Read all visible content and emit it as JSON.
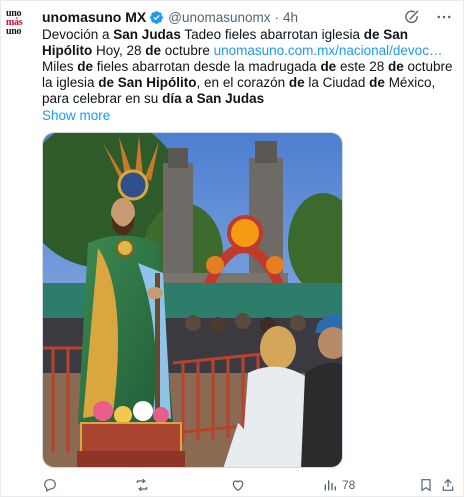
{
  "account": {
    "avatar_lines": [
      "uno",
      "más",
      "uno"
    ],
    "name": "unomasuno MX",
    "handle": "@unomasunomx",
    "separator": "·",
    "time": "4h"
  },
  "tweet": {
    "line1": [
      {
        "t": "Devoción a ",
        "s": "n"
      },
      {
        "t": "San Judas",
        "s": "b"
      },
      {
        "t": " Tadeo fieles abarrotan iglesia ",
        "s": "n"
      },
      {
        "t": "de San Hipólito",
        "s": "b"
      },
      {
        "t": " Hoy, 28 ",
        "s": "n"
      },
      {
        "t": "de",
        "s": "b"
      },
      {
        "t": " octubre ",
        "s": "n"
      },
      {
        "t": "unomasuno.com.mx/nacional/devoc…",
        "s": "link"
      }
    ],
    "line2": [
      {
        "t": "Miles ",
        "s": "n"
      },
      {
        "t": "de",
        "s": "b"
      },
      {
        "t": " fieles abarrotan desde la madrugada ",
        "s": "n"
      },
      {
        "t": "de",
        "s": "b"
      },
      {
        "t": " este 28 ",
        "s": "n"
      },
      {
        "t": "de",
        "s": "b"
      },
      {
        "t": " octubre la iglesia ",
        "s": "n"
      },
      {
        "t": "de San Hipólito",
        "s": "b"
      },
      {
        "t": ", en el corazón ",
        "s": "n"
      },
      {
        "t": "de",
        "s": "b"
      },
      {
        "t": " la Ciudad ",
        "s": "n"
      },
      {
        "t": "de",
        "s": "b"
      },
      {
        "t": " México, para celebrar en su ",
        "s": "n"
      },
      {
        "t": "día a San Judas",
        "s": "b"
      }
    ],
    "show_more": "Show more"
  },
  "actions": {
    "views_count": "78"
  },
  "colors": {
    "link": "#1d9bf0",
    "muted": "#536471",
    "verified": "#1d9bf0",
    "brand_red": "#c8102e"
  },
  "icons": [
    "verified-badge-icon",
    "grok-icon",
    "more-icon",
    "reply-icon",
    "retweet-icon",
    "like-icon",
    "views-icon",
    "bookmark-icon",
    "share-icon"
  ]
}
